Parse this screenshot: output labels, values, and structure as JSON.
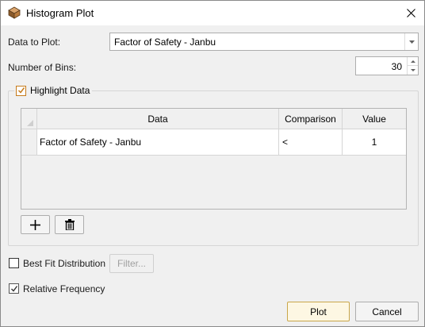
{
  "window": {
    "title": "Histogram Plot",
    "close_symbol": "✕"
  },
  "form": {
    "data_to_plot_label": "Data to Plot:",
    "data_to_plot_value": "Factor of Safety - Janbu",
    "num_bins_label": "Number of Bins:",
    "num_bins_value": "30"
  },
  "highlight": {
    "label": "Highlight Data",
    "checked": true,
    "columns": [
      "Data",
      "Comparison",
      "Value"
    ],
    "rows": [
      {
        "data": "Factor of Safety - Janbu",
        "comparison": "<",
        "value": "1"
      }
    ]
  },
  "options": {
    "best_fit_label": "Best Fit Distribution",
    "best_fit_checked": false,
    "filter_label": "Filter...",
    "relative_freq_label": "Relative Frequency",
    "relative_freq_checked": true
  },
  "buttons": {
    "plot": "Plot",
    "cancel": "Cancel"
  },
  "colors": {
    "accent": "#c67b1b",
    "border": "#adadad",
    "background": "#f0f0f0"
  }
}
